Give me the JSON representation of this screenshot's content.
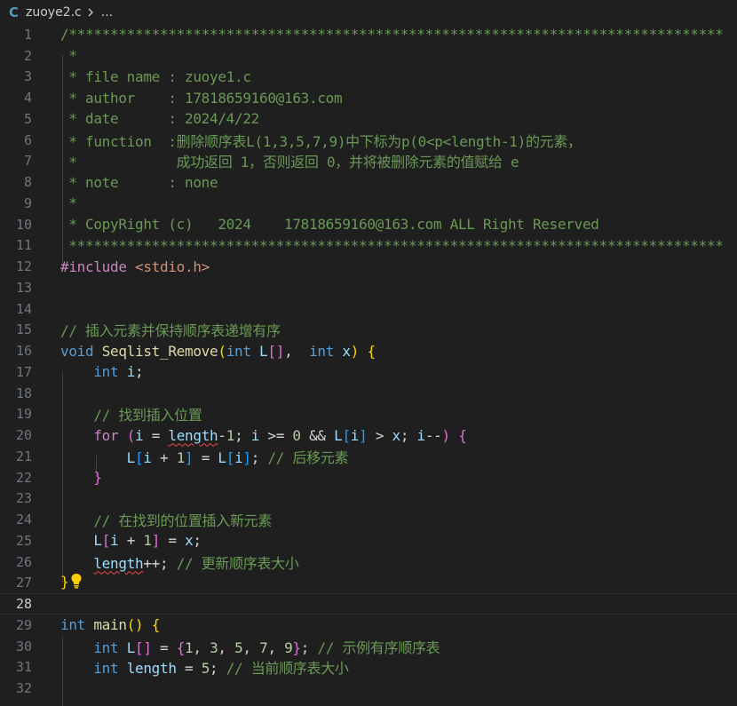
{
  "breadcrumb": {
    "file_icon_letter": "C",
    "file_name": "zuoye2.c",
    "ellipsis": "..."
  },
  "editor": {
    "line_numbers": [
      "1",
      "2",
      "3",
      "4",
      "5",
      "6",
      "7",
      "8",
      "9",
      "10",
      "11",
      "12",
      "13",
      "14",
      "15",
      "16",
      "17",
      "18",
      "19",
      "20",
      "21",
      "22",
      "23",
      "24",
      "25",
      "26",
      "27",
      "28",
      "29",
      "30",
      "31",
      "32"
    ],
    "current_line": "28",
    "header_comment": {
      "l1": "/*******************************************************************************",
      "l2": " *",
      "l3": " * file name : zuoye1.c",
      "l4": " * author    : 17818659160@163.com",
      "l5": " * date      : 2024/4/22",
      "l6": " * function  :删除顺序表L(1,3,5,7,9)中下标为p(0<p<length-1)的元素，",
      "l7": " *            成功返回 1，否则返回 0，并将被删除元素的值赋给 e",
      "l8": " * note      : none",
      "l9": " *",
      "l10": " * CopyRight (c)   2024    17818659160@163.com ALL Right Reserved",
      "l11": " *******************************************************************************"
    },
    "include_directive": "#include",
    "include_header": "<stdio.h>",
    "comment_insert": "// 插入元素并保持顺序表递增有序",
    "func_ret_type": "void",
    "func_name": "Seqlist_Remove",
    "kw_int": "int",
    "param_L": "L",
    "param_x": "x",
    "var_i": "i",
    "comment_find": "// 找到插入位置",
    "kw_for": "for",
    "var_length": "length",
    "num_0": "0",
    "num_1": "1",
    "comment_shift": "// 后移元素",
    "comment_insert_new": "// 在找到的位置插入新元素",
    "comment_update": "// 更新顺序表大小",
    "main_name": "main",
    "array_values": [
      "1",
      "3",
      "5",
      "7",
      "9"
    ],
    "comment_example": "// 示例有序顺序表",
    "num_5": "5",
    "comment_current_size": "// 当前顺序表大小"
  },
  "colors": {
    "background": "#1f1f1f",
    "comment": "#6a9955",
    "keyword": "#569cd6",
    "function": "#dcdcaa",
    "variable": "#9cdcfe",
    "number": "#b5cea8",
    "string": "#ce9178",
    "control": "#c586c0",
    "error_squiggle": "#f14c4c",
    "lightbulb": "#ffcc00"
  },
  "icons": {
    "breadcrumb_separator": "chevron-right-icon",
    "quick_fix": "lightbulb-icon"
  }
}
